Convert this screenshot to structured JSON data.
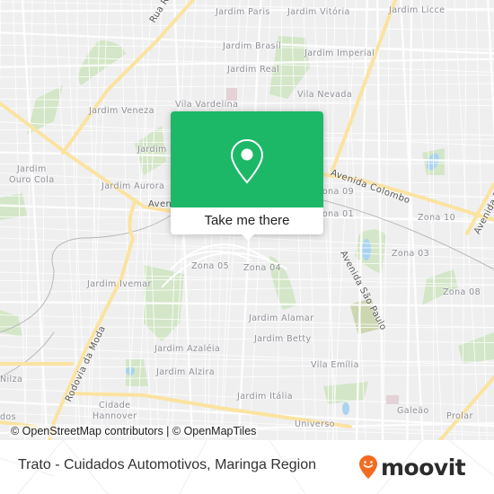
{
  "map": {
    "neighborhood_labels": [
      {
        "text": "Jardim Paris"
      },
      {
        "text": "Jardim Vitória"
      },
      {
        "text": "Jardim Licce"
      },
      {
        "text": "Jardim Brasil"
      },
      {
        "text": "Jardim Imperial"
      },
      {
        "text": "Jardim Real"
      },
      {
        "text": "Vila Nevada"
      },
      {
        "text": "Vila Vardelina"
      },
      {
        "text": "Jardim Veneza"
      },
      {
        "text": "Jardim"
      },
      {
        "text": "Jardim\nOuro Cola"
      },
      {
        "text": "Jardim Aurora"
      },
      {
        "text": "Zona 09"
      },
      {
        "text": "Zona 01"
      },
      {
        "text": "Zona 10"
      },
      {
        "text": "Zona 03"
      },
      {
        "text": "Zona 05"
      },
      {
        "text": "Zona 04"
      },
      {
        "text": "Zona 08"
      },
      {
        "text": "Jardim Ivemar"
      },
      {
        "text": "Jardim Alamar"
      },
      {
        "text": "Jardim Betty"
      },
      {
        "text": "Jardim Azaléia"
      },
      {
        "text": "Jardim Alzira"
      },
      {
        "text": "Vila Emília"
      },
      {
        "text": "Nilza"
      },
      {
        "text": "Jardim Itália"
      },
      {
        "text": "Cidade\nHannover"
      },
      {
        "text": "Galeão"
      },
      {
        "text": "Prolar"
      },
      {
        "text": "Universo"
      },
      {
        "text": "dos"
      },
      {
        "text": "Jardim"
      }
    ],
    "road_labels": [
      {
        "text": "Rua Rodolfo"
      },
      {
        "text": "Avenida Colombo"
      },
      {
        "text": "Aven"
      },
      {
        "text": "Avenida São Paulo"
      },
      {
        "text": "Rodovia da Moda"
      },
      {
        "text": "Avenida T"
      }
    ],
    "colors": {
      "background": "#efeff0",
      "street": "#ffffff",
      "major_road": "#fbe7a6",
      "park": "#cfe5c2",
      "water": "#a9d3f0"
    }
  },
  "popup": {
    "icon": "map-pin-icon",
    "cta_label": "Take me there",
    "color": "#1db768"
  },
  "attribution": "© OpenStreetMap contributors | © OpenMapTiles",
  "footer": {
    "place_title": "Trato - Cuidados Automotivos, Maringa Region",
    "brand_name": "moovit",
    "brand_icon": "moovit-smiley-pin-icon",
    "brand_color": "#f26b21"
  }
}
